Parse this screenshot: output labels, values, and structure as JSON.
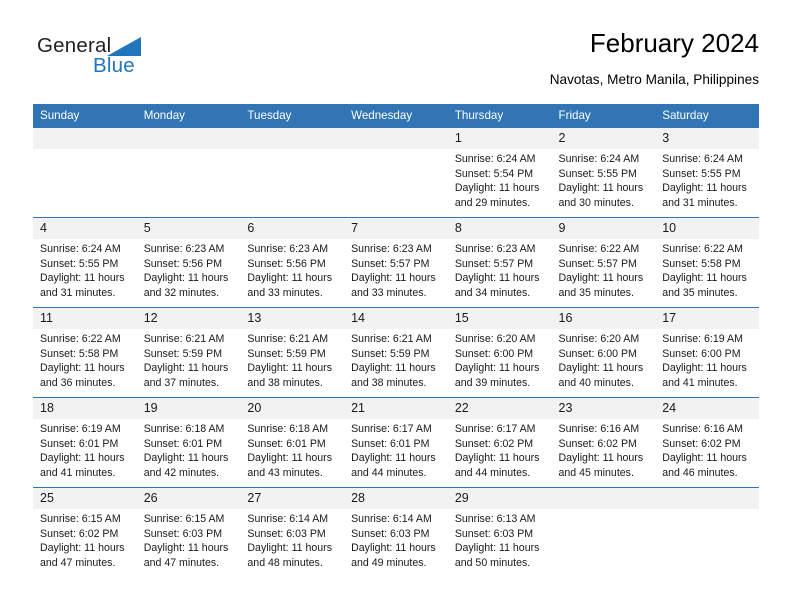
{
  "brand": {
    "name_part1": "General",
    "name_part2": "Blue",
    "triangle_color": "#1f76bc",
    "text_color": "#231f20"
  },
  "header": {
    "title": "February 2024",
    "subtitle": "Navotas, Metro Manila, Philippines"
  },
  "theme": {
    "header_blue": "#3175b4",
    "daynum_band": "#f2f2f2",
    "text": "#1a1a1a"
  },
  "weekdays": [
    "Sunday",
    "Monday",
    "Tuesday",
    "Wednesday",
    "Thursday",
    "Friday",
    "Saturday"
  ],
  "labels": {
    "sunrise": "Sunrise:",
    "sunset": "Sunset:",
    "daylight": "Daylight:"
  },
  "weeks": [
    [
      {
        "day": "",
        "empty": true
      },
      {
        "day": "",
        "empty": true
      },
      {
        "day": "",
        "empty": true
      },
      {
        "day": "",
        "empty": true
      },
      {
        "day": "1",
        "sunrise": "Sunrise: 6:24 AM",
        "sunset": "Sunset: 5:54 PM",
        "daylight_1": "Daylight: 11 hours",
        "daylight_2": "and 29 minutes."
      },
      {
        "day": "2",
        "sunrise": "Sunrise: 6:24 AM",
        "sunset": "Sunset: 5:55 PM",
        "daylight_1": "Daylight: 11 hours",
        "daylight_2": "and 30 minutes."
      },
      {
        "day": "3",
        "sunrise": "Sunrise: 6:24 AM",
        "sunset": "Sunset: 5:55 PM",
        "daylight_1": "Daylight: 11 hours",
        "daylight_2": "and 31 minutes."
      }
    ],
    [
      {
        "day": "4",
        "sunrise": "Sunrise: 6:24 AM",
        "sunset": "Sunset: 5:55 PM",
        "daylight_1": "Daylight: 11 hours",
        "daylight_2": "and 31 minutes."
      },
      {
        "day": "5",
        "sunrise": "Sunrise: 6:23 AM",
        "sunset": "Sunset: 5:56 PM",
        "daylight_1": "Daylight: 11 hours",
        "daylight_2": "and 32 minutes."
      },
      {
        "day": "6",
        "sunrise": "Sunrise: 6:23 AM",
        "sunset": "Sunset: 5:56 PM",
        "daylight_1": "Daylight: 11 hours",
        "daylight_2": "and 33 minutes."
      },
      {
        "day": "7",
        "sunrise": "Sunrise: 6:23 AM",
        "sunset": "Sunset: 5:57 PM",
        "daylight_1": "Daylight: 11 hours",
        "daylight_2": "and 33 minutes."
      },
      {
        "day": "8",
        "sunrise": "Sunrise: 6:23 AM",
        "sunset": "Sunset: 5:57 PM",
        "daylight_1": "Daylight: 11 hours",
        "daylight_2": "and 34 minutes."
      },
      {
        "day": "9",
        "sunrise": "Sunrise: 6:22 AM",
        "sunset": "Sunset: 5:57 PM",
        "daylight_1": "Daylight: 11 hours",
        "daylight_2": "and 35 minutes."
      },
      {
        "day": "10",
        "sunrise": "Sunrise: 6:22 AM",
        "sunset": "Sunset: 5:58 PM",
        "daylight_1": "Daylight: 11 hours",
        "daylight_2": "and 35 minutes."
      }
    ],
    [
      {
        "day": "11",
        "sunrise": "Sunrise: 6:22 AM",
        "sunset": "Sunset: 5:58 PM",
        "daylight_1": "Daylight: 11 hours",
        "daylight_2": "and 36 minutes."
      },
      {
        "day": "12",
        "sunrise": "Sunrise: 6:21 AM",
        "sunset": "Sunset: 5:59 PM",
        "daylight_1": "Daylight: 11 hours",
        "daylight_2": "and 37 minutes."
      },
      {
        "day": "13",
        "sunrise": "Sunrise: 6:21 AM",
        "sunset": "Sunset: 5:59 PM",
        "daylight_1": "Daylight: 11 hours",
        "daylight_2": "and 38 minutes."
      },
      {
        "day": "14",
        "sunrise": "Sunrise: 6:21 AM",
        "sunset": "Sunset: 5:59 PM",
        "daylight_1": "Daylight: 11 hours",
        "daylight_2": "and 38 minutes."
      },
      {
        "day": "15",
        "sunrise": "Sunrise: 6:20 AM",
        "sunset": "Sunset: 6:00 PM",
        "daylight_1": "Daylight: 11 hours",
        "daylight_2": "and 39 minutes."
      },
      {
        "day": "16",
        "sunrise": "Sunrise: 6:20 AM",
        "sunset": "Sunset: 6:00 PM",
        "daylight_1": "Daylight: 11 hours",
        "daylight_2": "and 40 minutes."
      },
      {
        "day": "17",
        "sunrise": "Sunrise: 6:19 AM",
        "sunset": "Sunset: 6:00 PM",
        "daylight_1": "Daylight: 11 hours",
        "daylight_2": "and 41 minutes."
      }
    ],
    [
      {
        "day": "18",
        "sunrise": "Sunrise: 6:19 AM",
        "sunset": "Sunset: 6:01 PM",
        "daylight_1": "Daylight: 11 hours",
        "daylight_2": "and 41 minutes."
      },
      {
        "day": "19",
        "sunrise": "Sunrise: 6:18 AM",
        "sunset": "Sunset: 6:01 PM",
        "daylight_1": "Daylight: 11 hours",
        "daylight_2": "and 42 minutes."
      },
      {
        "day": "20",
        "sunrise": "Sunrise: 6:18 AM",
        "sunset": "Sunset: 6:01 PM",
        "daylight_1": "Daylight: 11 hours",
        "daylight_2": "and 43 minutes."
      },
      {
        "day": "21",
        "sunrise": "Sunrise: 6:17 AM",
        "sunset": "Sunset: 6:01 PM",
        "daylight_1": "Daylight: 11 hours",
        "daylight_2": "and 44 minutes."
      },
      {
        "day": "22",
        "sunrise": "Sunrise: 6:17 AM",
        "sunset": "Sunset: 6:02 PM",
        "daylight_1": "Daylight: 11 hours",
        "daylight_2": "and 44 minutes."
      },
      {
        "day": "23",
        "sunrise": "Sunrise: 6:16 AM",
        "sunset": "Sunset: 6:02 PM",
        "daylight_1": "Daylight: 11 hours",
        "daylight_2": "and 45 minutes."
      },
      {
        "day": "24",
        "sunrise": "Sunrise: 6:16 AM",
        "sunset": "Sunset: 6:02 PM",
        "daylight_1": "Daylight: 11 hours",
        "daylight_2": "and 46 minutes."
      }
    ],
    [
      {
        "day": "25",
        "sunrise": "Sunrise: 6:15 AM",
        "sunset": "Sunset: 6:02 PM",
        "daylight_1": "Daylight: 11 hours",
        "daylight_2": "and 47 minutes."
      },
      {
        "day": "26",
        "sunrise": "Sunrise: 6:15 AM",
        "sunset": "Sunset: 6:03 PM",
        "daylight_1": "Daylight: 11 hours",
        "daylight_2": "and 47 minutes."
      },
      {
        "day": "27",
        "sunrise": "Sunrise: 6:14 AM",
        "sunset": "Sunset: 6:03 PM",
        "daylight_1": "Daylight: 11 hours",
        "daylight_2": "and 48 minutes."
      },
      {
        "day": "28",
        "sunrise": "Sunrise: 6:14 AM",
        "sunset": "Sunset: 6:03 PM",
        "daylight_1": "Daylight: 11 hours",
        "daylight_2": "and 49 minutes."
      },
      {
        "day": "29",
        "sunrise": "Sunrise: 6:13 AM",
        "sunset": "Sunset: 6:03 PM",
        "daylight_1": "Daylight: 11 hours",
        "daylight_2": "and 50 minutes."
      },
      {
        "day": "",
        "empty": true
      },
      {
        "day": "",
        "empty": true
      }
    ]
  ]
}
